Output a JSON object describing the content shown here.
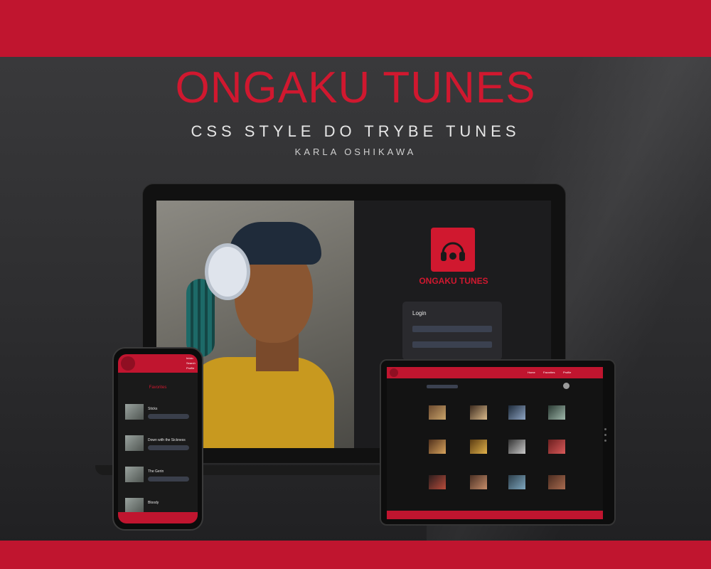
{
  "banner": {
    "title": "ONGAKU TUNES",
    "subtitle": "CSS STYLE DO TRYBE TUNES",
    "author": "KARLA OSHIKAWA"
  },
  "colors": {
    "accent": "#c0152f",
    "accent_text": "#d0182f",
    "background": "#2d2d2f"
  },
  "laptop": {
    "app_name": "ONGAKU TUNES",
    "login_title": "Login"
  },
  "phone": {
    "nav": [
      "Início",
      "Search",
      "Profile"
    ],
    "heading": "Favorites",
    "items": [
      {
        "title": "Sticks"
      },
      {
        "title": "Down with the Sickness"
      },
      {
        "title": "The Gerin"
      },
      {
        "title": "Bloody"
      }
    ]
  },
  "tablet": {
    "nav": [
      "Home",
      "Favorites",
      "Profile"
    ]
  }
}
